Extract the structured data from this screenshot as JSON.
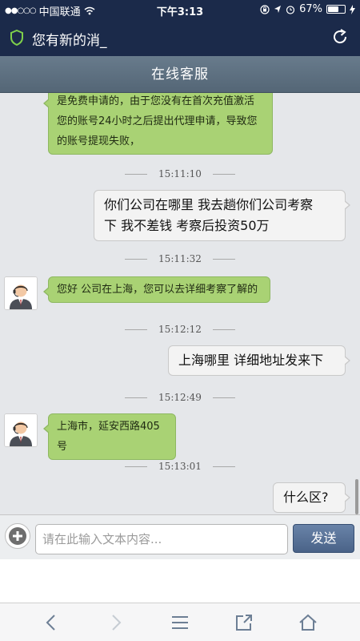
{
  "status_bar": {
    "carrier": "中国联通",
    "time": "下午3:13",
    "battery": "67%",
    "battery_level": 0.67
  },
  "app": {
    "title": "您有新的消_"
  },
  "chat": {
    "title": "在线客服",
    "messages": [
      {
        "from": "agent",
        "lines": [
          "是免费申请的，由于您没有在首次充值激活",
          "您的账号24小时之后提出代理申请，导致您",
          "的账号提现失败，"
        ]
      },
      {
        "timestamp": "15:11:10"
      },
      {
        "from": "user",
        "lines": [
          "你们公司在哪里  我去趟你们公司考察",
          "下  我不差钱  考察后投资50万"
        ]
      },
      {
        "timestamp": "15:11:32"
      },
      {
        "from": "agent",
        "lines": [
          "您好  公司在上海，您可以去详细考察了解的"
        ]
      },
      {
        "timestamp": "15:12:12"
      },
      {
        "from": "user",
        "lines": [
          "上海哪里  详细地址发来下"
        ]
      },
      {
        "timestamp": "15:12:49"
      },
      {
        "from": "agent",
        "lines": [
          "上海市，延安西路405号"
        ]
      },
      {
        "timestamp": "15:13:01"
      },
      {
        "from": "user",
        "lines": [
          "什么区?"
        ]
      }
    ]
  },
  "input_bar": {
    "placeholder": "请在此输入文本内容...",
    "value": "",
    "send_label": "发送"
  },
  "icons": {
    "shield": "shield-icon",
    "refresh": "refresh-icon",
    "add": "plus-circle-icon",
    "avatar": "agent-avatar-icon",
    "back": "chevron-left-icon",
    "forward": "chevron-right-icon",
    "menu": "menu-icon",
    "share": "share-icon",
    "home": "home-icon"
  },
  "colors": {
    "header_bg": "#1b2a4a",
    "title_bar_bg": "#607383",
    "agent_bubble": "#a9d274",
    "user_bubble": "#f3f3f3",
    "send_button": "#5a7396"
  }
}
